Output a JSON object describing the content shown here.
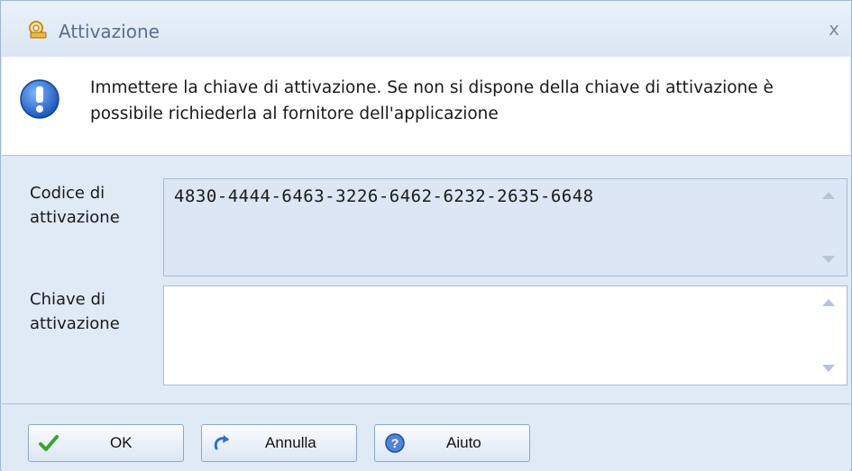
{
  "window": {
    "title": "Attivazione",
    "close_glyph": "x",
    "icon": "key-lock-icon"
  },
  "info": {
    "icon": "info-exclamation-icon",
    "message": "Immettere la chiave di attivazione. Se non si dispone della chiave di attivazione è possibile richiederla al fornitore dell'applicazione"
  },
  "fields": {
    "activation_code": {
      "label_line1": "Codice di",
      "label_line2": "attivazione",
      "value": "4830-4444-6463-3226-6462-6232-2635-6648"
    },
    "activation_key": {
      "label_line1": "Chiave di",
      "label_line2": "attivazione",
      "value": ""
    }
  },
  "buttons": {
    "ok": {
      "label": "OK",
      "icon": "checkmark-icon"
    },
    "cancel": {
      "label": "Annulla",
      "icon": "undo-arrow-icon"
    },
    "help": {
      "label": "Aiuto",
      "icon": "help-icon"
    }
  },
  "colors": {
    "accent": "#3a7bd5",
    "titlebar_bg": "#dbe6f4",
    "readonly_field_bg": "#dce6f4",
    "ok_check": "#3aa32c"
  }
}
